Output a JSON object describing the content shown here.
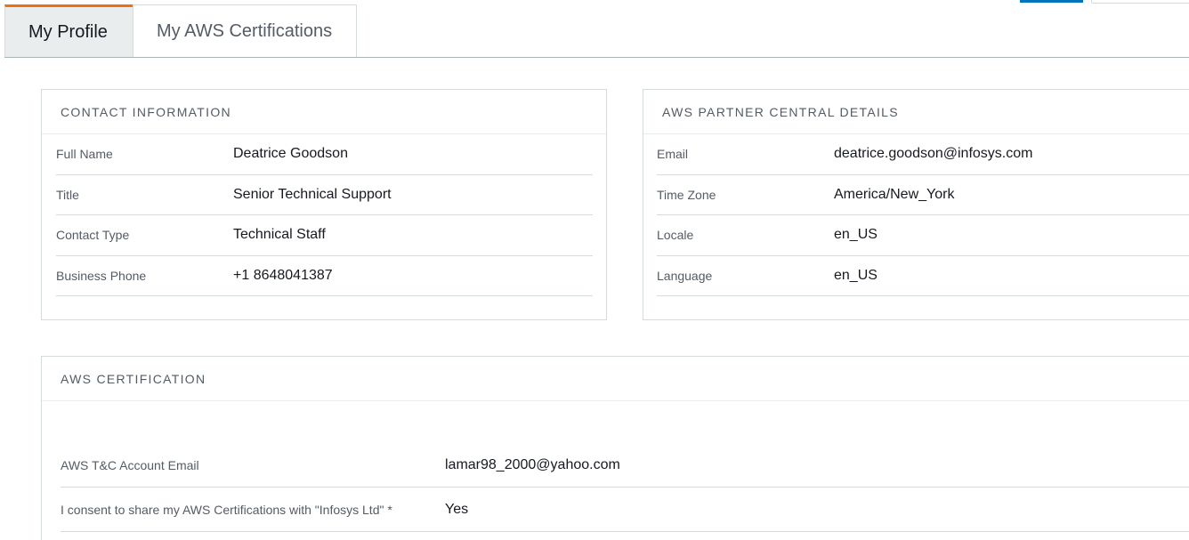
{
  "tabs": [
    {
      "label": "My Profile",
      "active": true
    },
    {
      "label": "My AWS Certifications",
      "active": false
    }
  ],
  "colors": {
    "active_tab_accent": "#ec7211",
    "primary_button": "#0073bb"
  },
  "contact_information": {
    "title": "CONTACT INFORMATION",
    "rows": [
      {
        "label": "Full Name",
        "value": "Deatrice Goodson"
      },
      {
        "label": "Title",
        "value": "Senior Technical Support"
      },
      {
        "label": "Contact Type",
        "value": "Technical Staff"
      },
      {
        "label": "Business Phone",
        "value": "+1 8648041387"
      }
    ]
  },
  "partner_central_details": {
    "title": "AWS PARTNER CENTRAL DETAILS",
    "rows": [
      {
        "label": "Email",
        "value": "deatrice.goodson@infosys.com"
      },
      {
        "label": "Time Zone",
        "value": "America/New_York"
      },
      {
        "label": "Locale",
        "value": "en_US"
      },
      {
        "label": "Language",
        "value": "en_US"
      }
    ]
  },
  "aws_certification": {
    "title": "AWS CERTIFICATION",
    "rows": [
      {
        "label": "AWS T&C Account Email",
        "value": "lamar98_2000@yahoo.com"
      },
      {
        "label": "I consent to share my AWS Certifications with \"Infosys Ltd\" *",
        "value": "Yes"
      }
    ]
  }
}
